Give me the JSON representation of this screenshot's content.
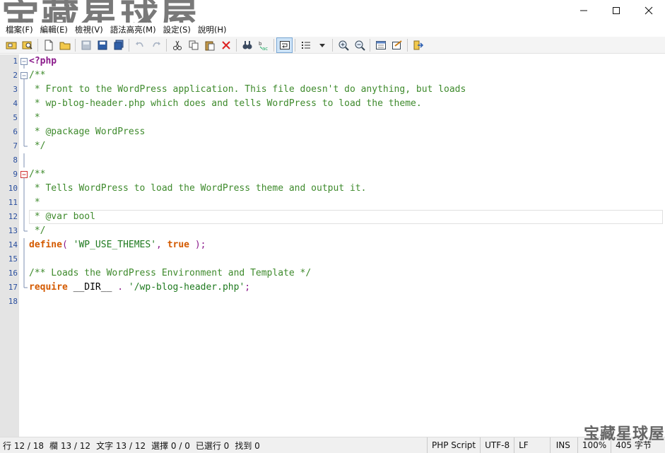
{
  "watermark": {
    "top": "宝藏星球屋",
    "bottom": "宝藏星球屋"
  },
  "window_controls": {
    "minimize": "—",
    "maximize": "☐",
    "close": "✕"
  },
  "menu": [
    {
      "name": "menu-file",
      "label": "檔案(F)"
    },
    {
      "name": "menu-edit",
      "label": "編輯(E)"
    },
    {
      "name": "menu-view",
      "label": "檢視(V)"
    },
    {
      "name": "menu-syntax",
      "label": "語法高亮(M)"
    },
    {
      "name": "menu-settings",
      "label": "設定(S)"
    },
    {
      "name": "menu-help",
      "label": "說明(H)"
    }
  ],
  "toolbar_icons": [
    "new-window-icon",
    "find-in-files-icon",
    "new-file-icon",
    "open-folder-icon",
    "save-gray-icon",
    "save-icon",
    "save-all-icon",
    "undo-icon",
    "redo-icon",
    "cut-icon",
    "copy-icon",
    "paste-icon",
    "delete-icon",
    "find-icon",
    "replace-icon",
    "word-wrap-icon",
    "list-icon",
    "zoom-in-icon",
    "zoom-out-icon",
    "scheme-icon",
    "settings-icon",
    "exit-icon"
  ],
  "code_lines": [
    {
      "n": "1",
      "fold": "box-minus",
      "tokens": [
        {
          "t": "<?php",
          "c": "c-tag"
        }
      ]
    },
    {
      "n": "2",
      "fold": "box-minus",
      "tokens": [
        {
          "t": "/**",
          "c": "c-comment"
        }
      ]
    },
    {
      "n": "3",
      "fold": "line",
      "tokens": [
        {
          "t": " * Front to the WordPress application. This file doesn't do anything, but loads",
          "c": "c-comment"
        }
      ]
    },
    {
      "n": "4",
      "fold": "line",
      "tokens": [
        {
          "t": " * wp-blog-header.php which does and tells WordPress to load the theme.",
          "c": "c-comment"
        }
      ]
    },
    {
      "n": "5",
      "fold": "line",
      "tokens": [
        {
          "t": " *",
          "c": "c-comment"
        }
      ]
    },
    {
      "n": "6",
      "fold": "line",
      "tokens": [
        {
          "t": " * @package WordPress",
          "c": "c-comment"
        }
      ]
    },
    {
      "n": "7",
      "fold": "end",
      "tokens": [
        {
          "t": " */",
          "c": "c-comment"
        }
      ]
    },
    {
      "n": "8",
      "fold": "line",
      "tokens": [
        {
          "t": "",
          "c": "c-plain"
        }
      ]
    },
    {
      "n": "9",
      "fold": "box-minus-red",
      "tokens": [
        {
          "t": "/**",
          "c": "c-comment"
        }
      ]
    },
    {
      "n": "10",
      "fold": "line",
      "tokens": [
        {
          "t": " * Tells WordPress to load the WordPress theme and output it.",
          "c": "c-comment"
        }
      ]
    },
    {
      "n": "11",
      "fold": "line",
      "tokens": [
        {
          "t": " *",
          "c": "c-comment"
        }
      ]
    },
    {
      "n": "12",
      "fold": "line",
      "current": true,
      "tokens": [
        {
          "t": " * @var bool",
          "c": "c-comment"
        }
      ]
    },
    {
      "n": "13",
      "fold": "end",
      "tokens": [
        {
          "t": " */",
          "c": "c-comment"
        }
      ]
    },
    {
      "n": "14",
      "fold": "line",
      "tokens": [
        {
          "t": "define",
          "c": "c-kw"
        },
        {
          "t": "( ",
          "c": "c-punct"
        },
        {
          "t": "'WP_USE_THEMES'",
          "c": "c-str"
        },
        {
          "t": ", ",
          "c": "c-punct"
        },
        {
          "t": "true",
          "c": "c-kw"
        },
        {
          "t": " );",
          "c": "c-punct"
        }
      ]
    },
    {
      "n": "15",
      "fold": "line",
      "tokens": [
        {
          "t": "",
          "c": "c-plain"
        }
      ]
    },
    {
      "n": "16",
      "fold": "line",
      "tokens": [
        {
          "t": "/** Loads the WordPress Environment and Template */",
          "c": "c-comment"
        }
      ]
    },
    {
      "n": "17",
      "fold": "end",
      "tokens": [
        {
          "t": "require",
          "c": "c-kw"
        },
        {
          "t": " __DIR__ ",
          "c": "c-plain"
        },
        {
          "t": ". ",
          "c": "c-punct"
        },
        {
          "t": "'/wp-blog-header.php'",
          "c": "c-str"
        },
        {
          "t": ";",
          "c": "c-punct"
        }
      ]
    },
    {
      "n": "18",
      "fold": "none",
      "tokens": [
        {
          "t": "",
          "c": "c-plain"
        }
      ]
    }
  ],
  "status": {
    "row": "行 12 / 18",
    "col": "欄 13 / 12",
    "char": "文字 13 / 12",
    "selection": "選擇 0 / 0",
    "selected_lines": "已選行 0",
    "found": "找到 0",
    "syntax": "PHP Script",
    "encoding": "UTF-8",
    "eol": "LF",
    "mode": "INS",
    "zoom": "100%",
    "size": "405 字节"
  }
}
